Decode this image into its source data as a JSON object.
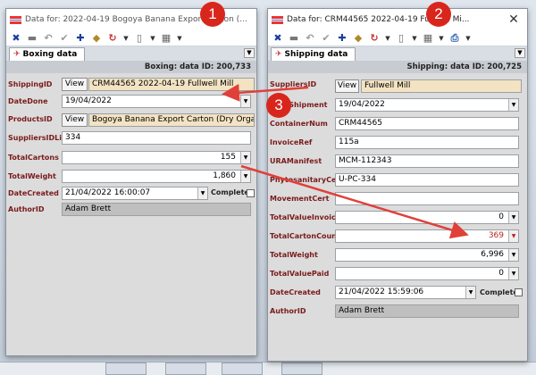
{
  "background": {
    "buttons": [
      "",
      "",
      "",
      ""
    ]
  },
  "win1": {
    "title": "Data for: 2022-04-19 Bogoya Banana Export Carton (Dry Organ...",
    "tab": "Boxing data",
    "header": "Boxing: data ID: 200,733",
    "fields": {
      "shippingid_label": "ShippingID",
      "shippingid_value": "CRM44565 2022-04-19 Fullwell Mill",
      "datedone_label": "DateDone",
      "datedone_value": "19/04/2022",
      "productsid_label": "ProductsID",
      "productsid_value": "Bogoya Banana Export Carton (Dry Organic",
      "suppliers_label": "SuppliersIDList",
      "suppliers_value": "334",
      "totalcartons_label": "TotalCartons",
      "totalcartons_value": "155",
      "totalweight_label": "TotalWeight",
      "totalweight_value": "1,860",
      "datecreated_label": "DateCreated",
      "datecreated_value": "21/04/2022 16:00:07",
      "complete_label": "Complete",
      "authorid_label": "AuthorID",
      "authorid_value": "Adam Brett"
    },
    "view_label": "View"
  },
  "win2": {
    "title": "Data for: CRM44565 2022-04-19 Fullwell Mi...",
    "tab": "Shipping data",
    "header": "Shipping: data ID: 200,725",
    "fields": {
      "suppliersid_label": "SuppliersID",
      "suppliersid_value": "Fullwell Mill",
      "dateshipment_label": "DateShipment",
      "dateshipment_value": "19/04/2022",
      "containernum_label": "ContainerNum",
      "containernum_value": "CRM44565",
      "invoiceref_label": "InvoiceRef",
      "invoiceref_value": "115a",
      "uramanifest_label": "URAManifest",
      "uramanifest_value": "MCM-112343",
      "phyto_label": "PhytosanitaryCert",
      "phyto_value": "U-PC-334",
      "movement_label": "MovementCert",
      "movement_value": "",
      "tvi_label": "TotalValueInvoiced",
      "tvi_value": "0",
      "tcc_label": "TotalCartonCount",
      "tcc_value": "369",
      "tw_label": "TotalWeight",
      "tw_value": "6,996",
      "tvp_label": "TotalValuePaid",
      "tvp_value": "0",
      "datecreated_label": "DateCreated",
      "datecreated_value": "21/04/2022 15:59:06",
      "complete_label": "Complete",
      "authorid_label": "AuthorID",
      "authorid_value": "Adam Brett"
    },
    "view_label": "View"
  },
  "annotations": {
    "b1": "1",
    "b2": "2",
    "b3": "3"
  },
  "colors": {
    "arrow": "#e0403a",
    "badge": "#d9261c"
  }
}
